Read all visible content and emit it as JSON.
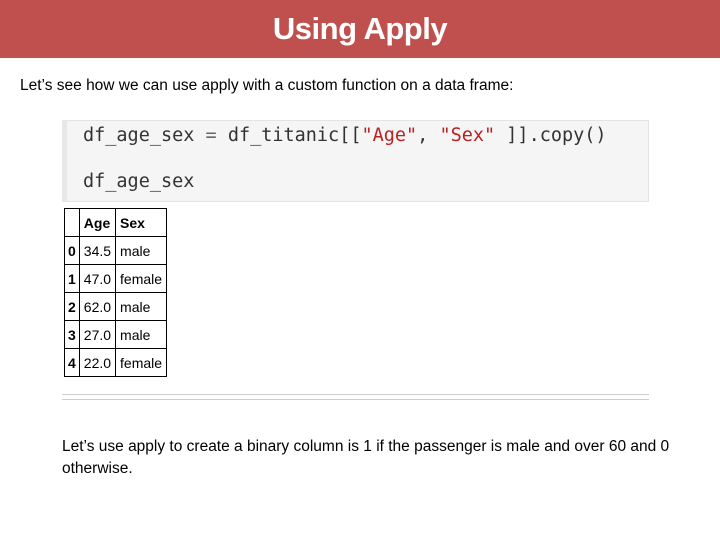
{
  "slide": {
    "title": "Using Apply",
    "intro": "Let’s see how we can use apply with a custom function on a data frame:",
    "bottom_text": "Let’s use apply to create a binary column is 1 if the passenger is male and over 60 and 0 otherwise."
  },
  "code": {
    "line1_var": "df_age_sex",
    "line1_eq": " = ",
    "line1_call_start": "df_titanic[[",
    "line1_str1": "\"Age\"",
    "line1_comma": ", ",
    "line1_str2": "\"Sex\"",
    "line1_call_end": " ]].copy()",
    "line2": "df_age_sex"
  },
  "table": {
    "columns": [
      "",
      "Age",
      "Sex"
    ],
    "rows": [
      [
        "0",
        "34.5",
        "male"
      ],
      [
        "1",
        "47.0",
        "female"
      ],
      [
        "2",
        "62.0",
        "male"
      ],
      [
        "3",
        "27.0",
        "male"
      ],
      [
        "4",
        "22.0",
        "female"
      ]
    ]
  },
  "colors": {
    "title_bar": "#c0504d",
    "code_string": "#ba2121"
  }
}
